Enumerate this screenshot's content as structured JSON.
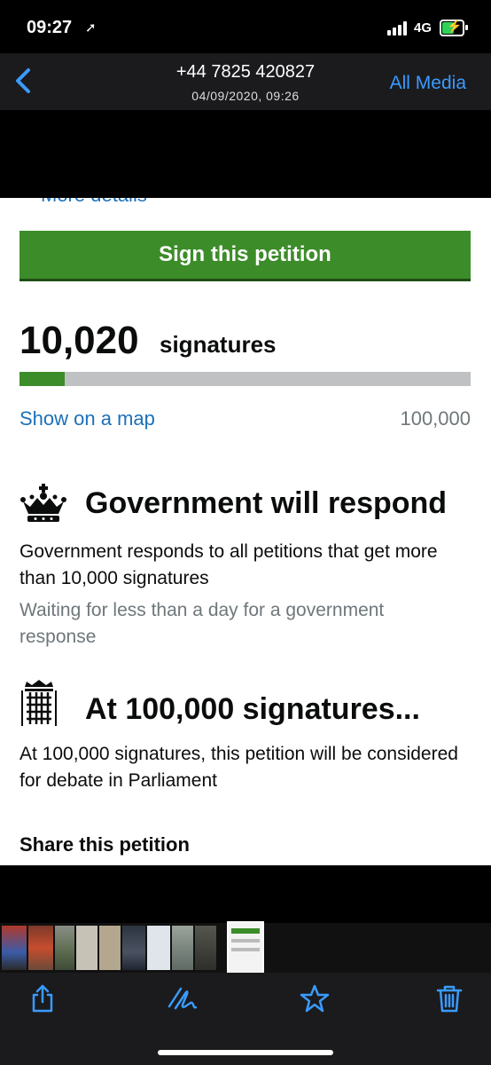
{
  "status_bar": {
    "time": "09:27",
    "network": "4G"
  },
  "header": {
    "title": "+44 7825 420827",
    "subtitle": "04/09/2020, 09:26",
    "all_media": "All Media"
  },
  "petition": {
    "cut_link": "More details",
    "sign_button": "Sign this petition",
    "signature_count": "10,020",
    "signature_label": "signatures",
    "progress_fraction": 0.1002,
    "map_link": "Show on a map",
    "threshold": "100,000",
    "response_heading": "Government will respond",
    "response_text": "Government responds to all petitions that get more than 10,000 signatures",
    "response_status": "Waiting for less than a day for a government response",
    "debate_heading": "At 100,000 signatures...",
    "debate_text": "At 100,000 signatures, this petition will be considered for debate in Parliament",
    "share_heading": "Share this petition"
  },
  "colors": {
    "accent": "#3a9bff",
    "petition_green": "#3d8c2a",
    "link_blue": "#1d70b8"
  },
  "toolbar": {
    "icons": [
      "share-icon",
      "markup-icon",
      "star-icon",
      "trash-icon"
    ]
  }
}
